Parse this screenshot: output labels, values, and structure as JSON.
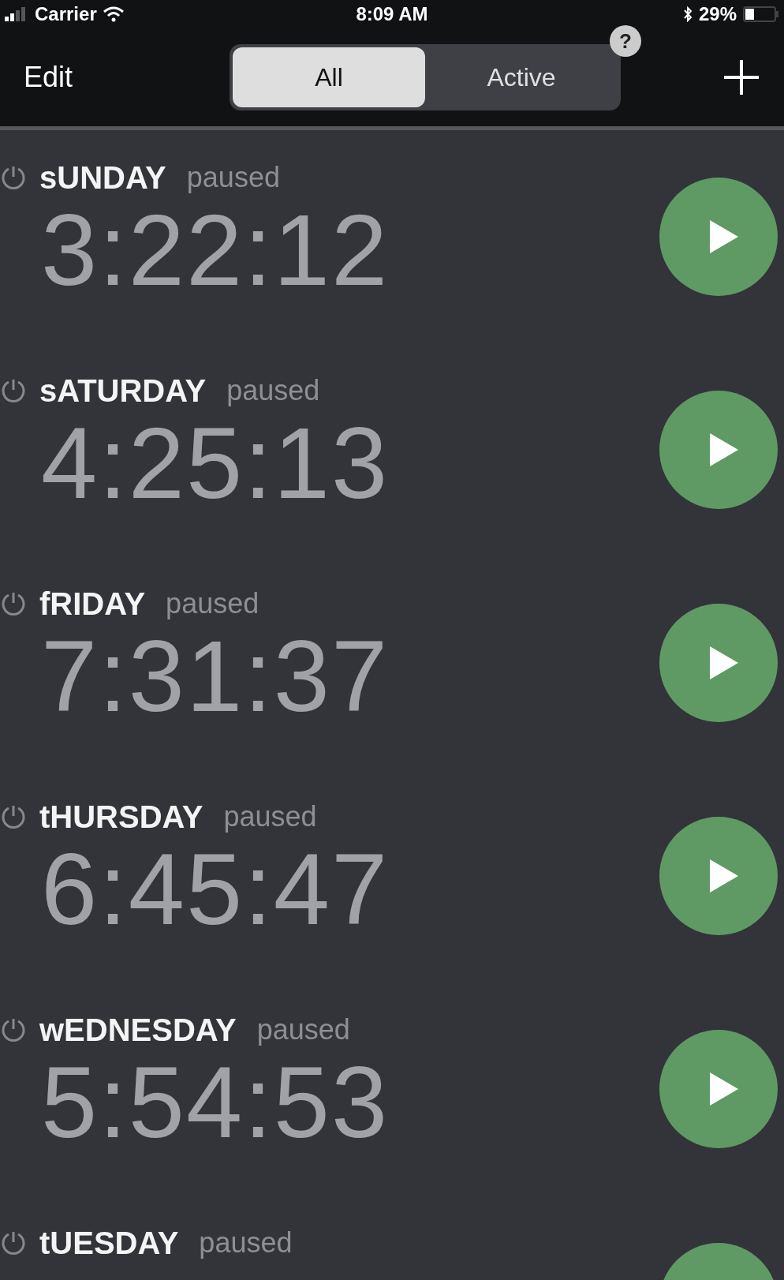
{
  "status_bar": {
    "carrier": "Carrier",
    "time": "8:09 AM",
    "battery": "29%"
  },
  "nav": {
    "edit": "Edit",
    "tabs": [
      {
        "label": "All",
        "selected": true
      },
      {
        "label": "Active",
        "selected": false
      }
    ],
    "badge": "?"
  },
  "timers": [
    {
      "name": "sUNDAY",
      "status": "paused",
      "time": "3:22:12"
    },
    {
      "name": "sATURDAY",
      "status": "paused",
      "time": "4:25:13"
    },
    {
      "name": "fRIDAY",
      "status": "paused",
      "time": "7:31:37"
    },
    {
      "name": "tHURSDAY",
      "status": "paused",
      "time": "6:45:47"
    },
    {
      "name": "wEDNESDAY",
      "status": "paused",
      "time": "5:54:53"
    },
    {
      "name": "tUESDAY",
      "status": "paused"
    }
  ]
}
